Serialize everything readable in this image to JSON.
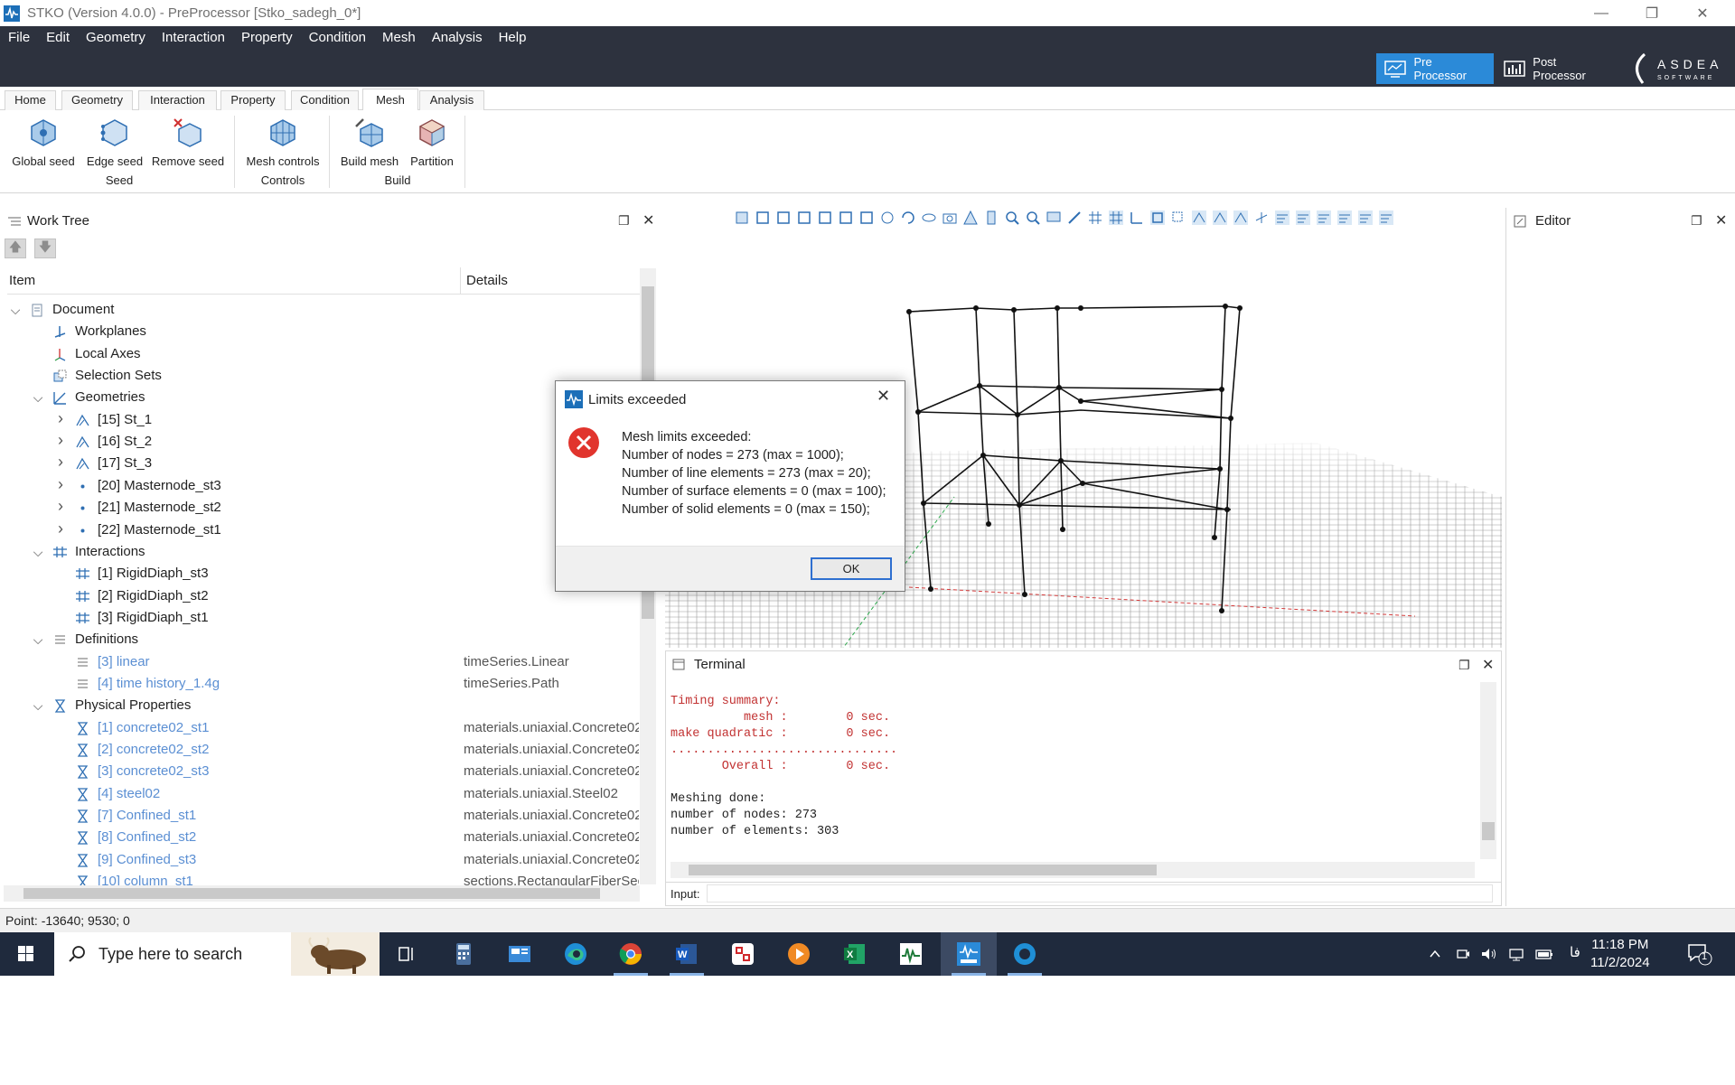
{
  "window": {
    "title": "STKO (Version 4.0.0) - PreProcessor [Stko_sadegh_0*]"
  },
  "menu": [
    "File",
    "Edit",
    "Geometry",
    "Interaction",
    "Property",
    "Condition",
    "Mesh",
    "Analysis",
    "Help"
  ],
  "processors": {
    "pre": "Pre Processor",
    "post": "Post Processor"
  },
  "brand": {
    "name": "ASDEA",
    "sub": "SOFTWARE"
  },
  "ribbon": {
    "tabs": [
      "Home",
      "Geometry",
      "Interaction",
      "Property",
      "Condition",
      "Mesh",
      "Analysis"
    ],
    "active_tab": "Mesh",
    "buttons": [
      "Global seed",
      "Edge seed",
      "Remove seed",
      "Mesh controls",
      "Build mesh",
      "Partition"
    ],
    "groups": [
      "Seed",
      "Controls",
      "Build"
    ]
  },
  "worktree": {
    "title": "Work Tree",
    "col_item": "Item",
    "col_details": "Details",
    "rows": [
      {
        "label": "Document",
        "details": ""
      },
      {
        "label": "Workplanes",
        "details": ""
      },
      {
        "label": "Local Axes",
        "details": ""
      },
      {
        "label": "Selection Sets",
        "details": ""
      },
      {
        "label": "Geometries",
        "details": ""
      },
      {
        "label": "[15] St_1",
        "details": ""
      },
      {
        "label": "[16] St_2",
        "details": ""
      },
      {
        "label": "[17] St_3",
        "details": ""
      },
      {
        "label": "[20] Masternode_st3",
        "details": ""
      },
      {
        "label": "[21] Masternode_st2",
        "details": ""
      },
      {
        "label": "[22] Masternode_st1",
        "details": ""
      },
      {
        "label": "Interactions",
        "details": ""
      },
      {
        "label": "[1] RigidDiaph_st3",
        "details": ""
      },
      {
        "label": "[2] RigidDiaph_st2",
        "details": ""
      },
      {
        "label": "[3] RigidDiaph_st1",
        "details": ""
      },
      {
        "label": "Definitions",
        "details": ""
      },
      {
        "label": "[3] linear",
        "details": "timeSeries.Linear"
      },
      {
        "label": "[4] time history_1.4g",
        "details": "timeSeries.Path"
      },
      {
        "label": "Physical Properties",
        "details": ""
      },
      {
        "label": "[1] concrete02_st1",
        "details": "materials.uniaxial.Concrete02"
      },
      {
        "label": "[2] concrete02_st2",
        "details": "materials.uniaxial.Concrete02"
      },
      {
        "label": "[3] concrete02_st3",
        "details": "materials.uniaxial.Concrete02"
      },
      {
        "label": "[4] steel02",
        "details": "materials.uniaxial.Steel02"
      },
      {
        "label": "[7] Confined_st1",
        "details": "materials.uniaxial.Concrete02"
      },
      {
        "label": "[8] Confined_st2",
        "details": "materials.uniaxial.Concrete02"
      },
      {
        "label": "[9] Confined_st3",
        "details": "materials.uniaxial.Concrete02"
      },
      {
        "label": "[10] column_st1",
        "details": "sections.RectangularFiberSec"
      }
    ]
  },
  "editor": {
    "title": "Editor"
  },
  "terminal": {
    "title": "Terminal",
    "lines": [
      "Timing summary:",
      "          mesh :        0 sec.",
      "make quadratic :        0 sec.",
      "...............................",
      "       Overall :        0 sec.",
      "",
      "Meshing done:",
      "number of nodes: 273",
      "number of elements: 303"
    ],
    "input_label": "Input:"
  },
  "status": {
    "text": "Point: -13640; 9530; 0"
  },
  "dialog": {
    "title": "Limits exceeded",
    "lines": [
      "Mesh limits exceeded:",
      "Number of nodes = 273 (max = 1000);",
      "Number of line elements = 273 (max = 20);",
      "Number of surface elements = 0 (max = 100);",
      "Number of solid elements = 0 (max = 150);"
    ],
    "ok": "OK"
  },
  "taskbar": {
    "search_placeholder": "Type here to search",
    "time": "11:18 PM",
    "date": "11/2/2024",
    "lang": "فا",
    "notifications": "1"
  },
  "colors": {
    "menubar": "#2d323e",
    "accent": "#2b8ad8",
    "terminal_red": "#c23232",
    "link": "#5b8fd3"
  }
}
